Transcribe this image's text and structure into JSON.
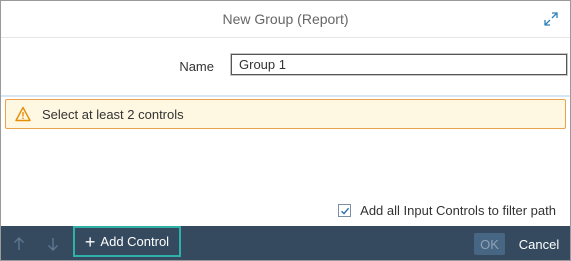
{
  "dialog": {
    "title": "New Group (Report)",
    "expand_icon": "expand-icon"
  },
  "form": {
    "name_label": "Name",
    "name_value": "Group 1"
  },
  "warning": {
    "icon": "warning-icon",
    "text": "Select at least 2 controls"
  },
  "options": {
    "add_all_label": "Add all Input Controls to filter path",
    "add_all_checked": true
  },
  "footer": {
    "move_up_icon": "arrow-up-icon",
    "move_down_icon": "arrow-down-icon",
    "add_control_label": "Add Control",
    "ok_label": "OK",
    "cancel_label": "Cancel"
  },
  "colors": {
    "footer_bg": "#354a5f",
    "warning_bg": "#fef7e1",
    "warning_border": "#e9a34c",
    "focus_border": "#2fb0a9"
  }
}
